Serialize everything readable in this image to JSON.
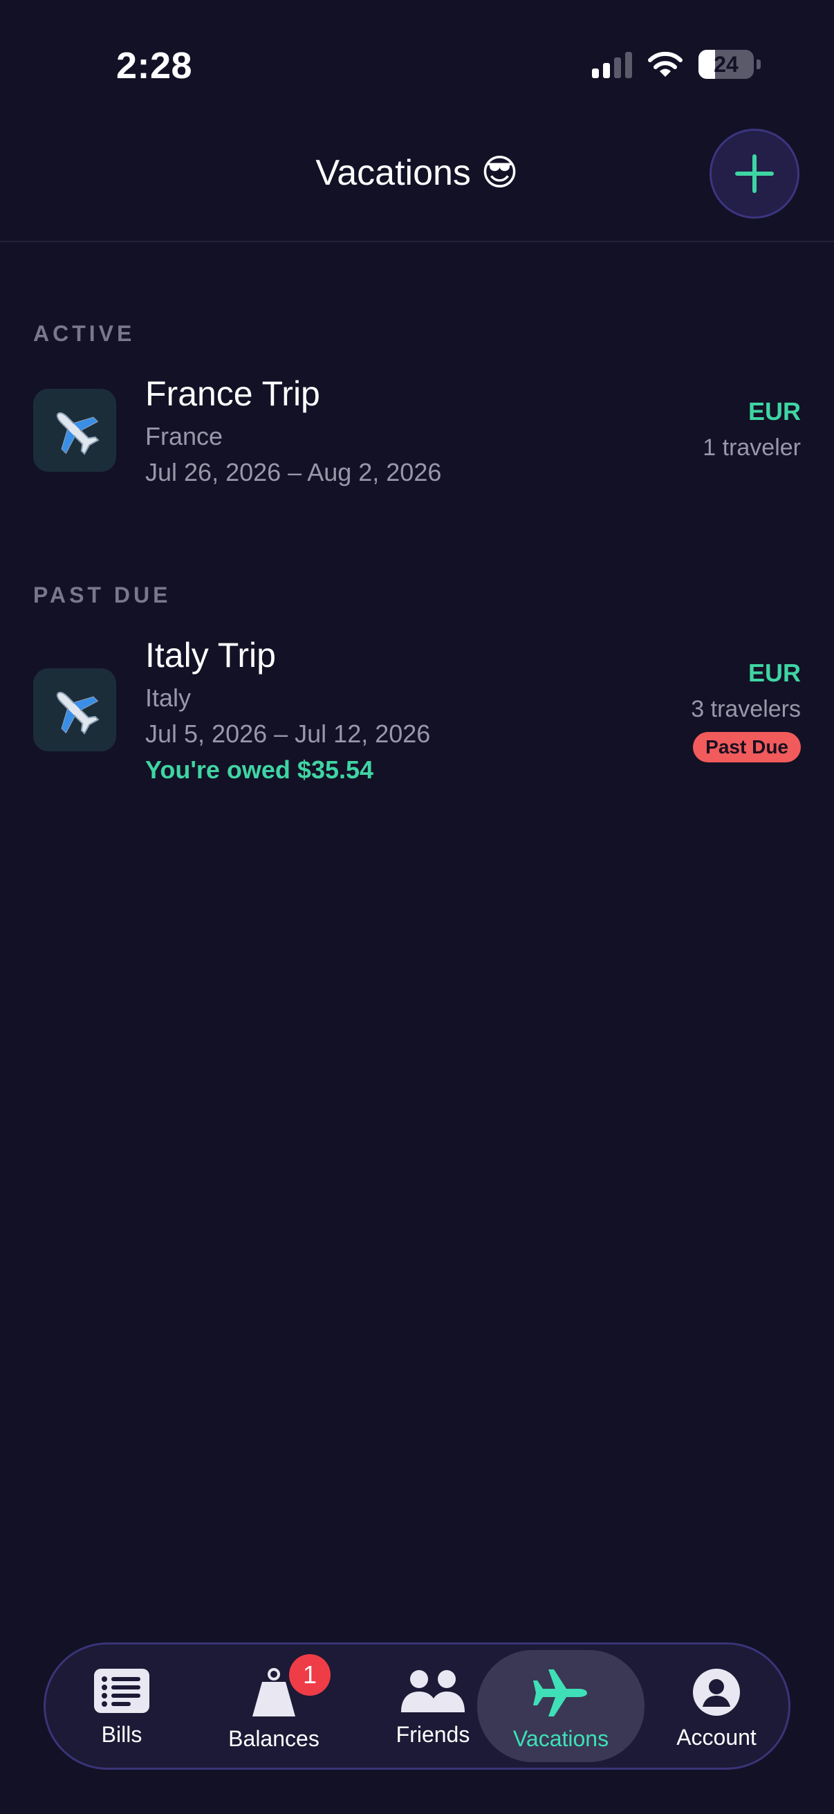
{
  "status": {
    "time": "2:28",
    "battery": "24"
  },
  "header": {
    "title": "Vacations 😎",
    "add_icon": "plus-icon"
  },
  "sections": [
    {
      "label": "ACTIVE",
      "trips": [
        {
          "name": "France Trip",
          "country": "France",
          "dates": "Jul 26, 2026 – Aug 2, 2026",
          "currency": "EUR",
          "travelers": "1 traveler",
          "icon": "airplane-icon"
        }
      ]
    },
    {
      "label": "PAST DUE",
      "trips": [
        {
          "name": "Italy Trip",
          "country": "Italy",
          "dates": "Jul 5, 2026 – Jul 12, 2026",
          "owed": "You're owed $35.54",
          "currency": "EUR",
          "travelers": "3 travelers",
          "badge": "Past Due",
          "icon": "airplane-icon"
        }
      ]
    }
  ],
  "tabs": [
    {
      "label": "Bills",
      "icon": "list-icon"
    },
    {
      "label": "Balances",
      "icon": "weight-icon",
      "badge": "1"
    },
    {
      "label": "Friends",
      "icon": "people-icon"
    },
    {
      "label": "Vacations",
      "icon": "airplane-icon",
      "active": true
    },
    {
      "label": "Account",
      "icon": "person-icon"
    }
  ],
  "colors": {
    "background": "#131126",
    "accent": "#3fd5a3",
    "danger": "#f25b5b",
    "badge": "#ef3d47"
  }
}
